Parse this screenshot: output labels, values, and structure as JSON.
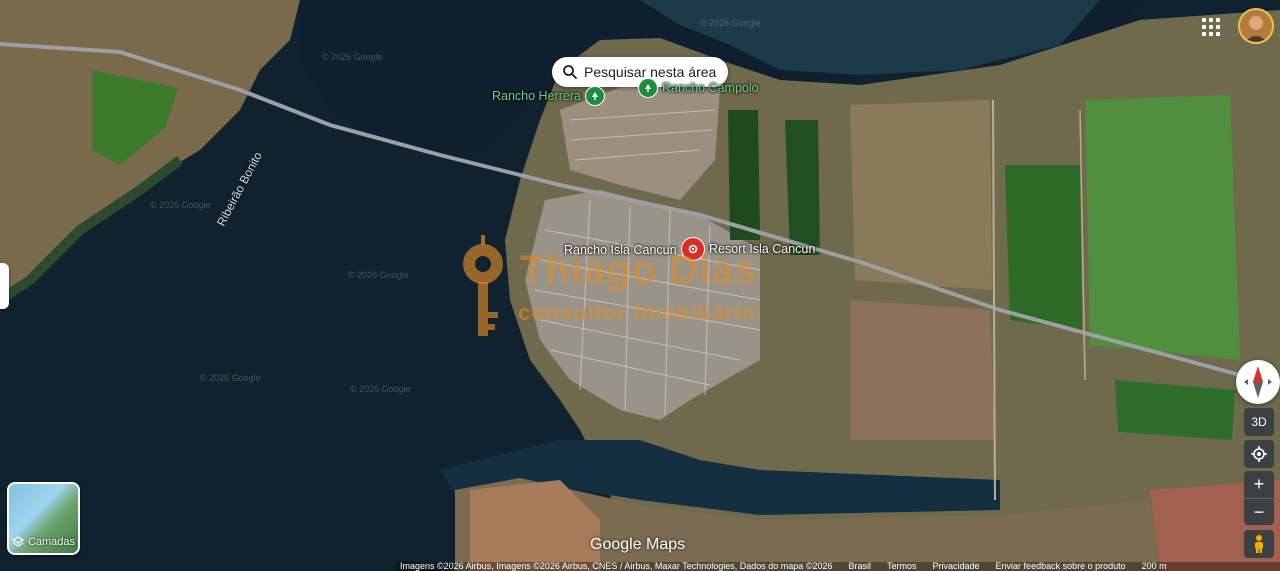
{
  "search_area_button": {
    "label": "Pesquisar nesta área"
  },
  "places": [
    {
      "name": "Rancho Herrera",
      "color": "#6fd38a"
    },
    {
      "name": "Rancho Campolo",
      "color": "#6fd38a"
    },
    {
      "name": "Rancho Isla Cancun",
      "color": "#ffffff"
    },
    {
      "name": "Resort Isla Cancun",
      "color": "#ffffff"
    }
  ],
  "water_label": "Ribeirão Bonito",
  "watermark_text": "© 2026 Google",
  "overlay_brand": {
    "line1": "Thiago Dias",
    "line2": "consultor imobiliário",
    "color": "#e08c28"
  },
  "controls": {
    "layers_label": "Camadas",
    "three_d_label": "3D",
    "zoom_in": "+",
    "zoom_out": "−"
  },
  "icons": [
    "search-icon",
    "apps-grid-icon",
    "layers-icon",
    "compass-icon",
    "my-location-icon",
    "pegman-icon",
    "key-icon",
    "resort-pin-icon",
    "park-pin-icon"
  ],
  "logo_text": "Google Maps",
  "footer": {
    "attribution": "Imagens ©2026 Airbus, Imagens ©2026 Airbus, CNES / Airbus, Maxar Technologies, Dados do mapa ©2026",
    "links": [
      "Brasil",
      "Termos",
      "Privacidade",
      "Enviar feedback sobre o produto"
    ],
    "scale": "200 m"
  },
  "colors": {
    "water": "#0f1f2e",
    "road": "#8a8f93",
    "accent_red": "#d93025",
    "green_poi": "#1e8e3e"
  }
}
